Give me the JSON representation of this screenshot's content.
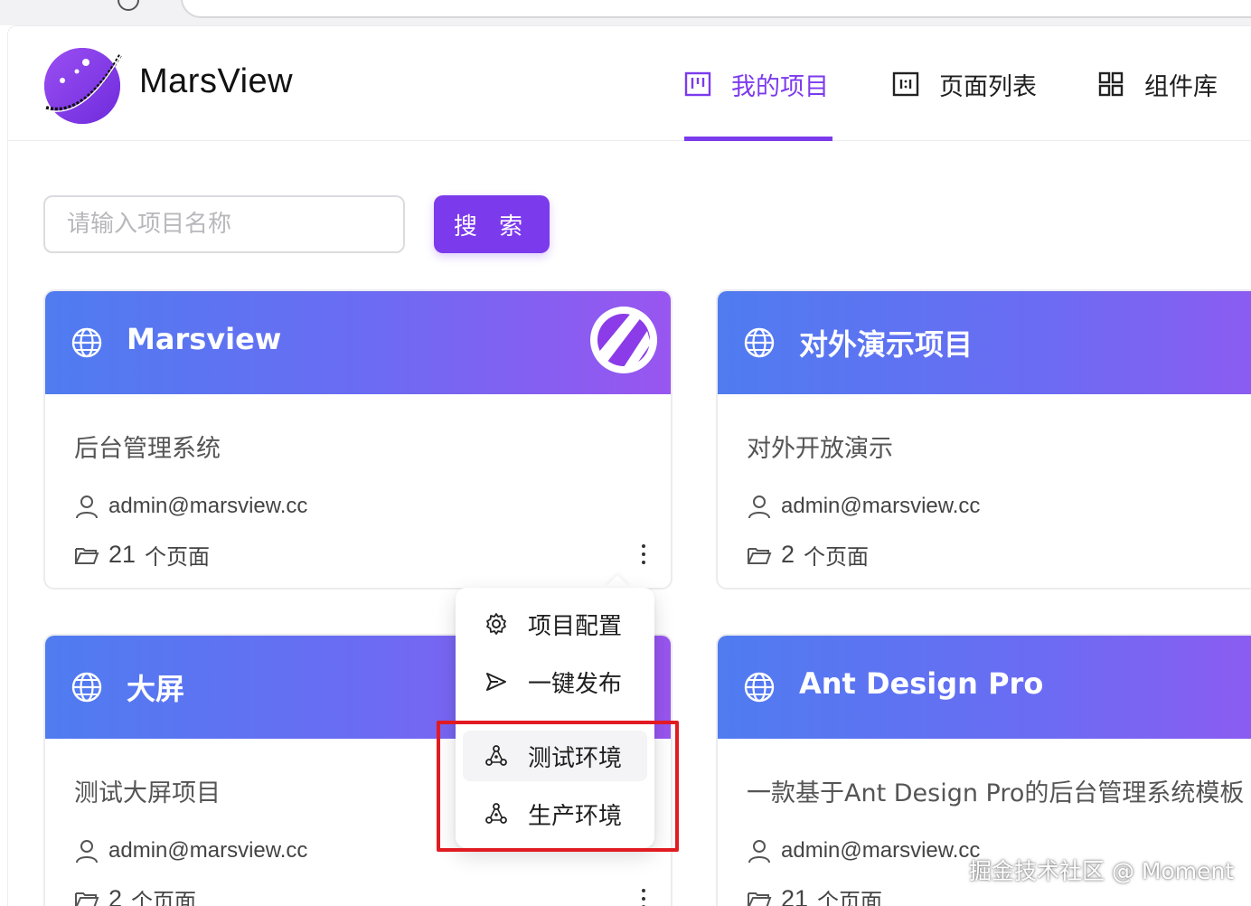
{
  "app": {
    "brand": "MarsView"
  },
  "nav": {
    "items": [
      {
        "label": "我的项目",
        "icon": "project-board-icon",
        "active": true
      },
      {
        "label": "页面列表",
        "icon": "page-list-icon",
        "active": false
      },
      {
        "label": "组件库",
        "icon": "component-grid-icon",
        "active": false
      }
    ]
  },
  "search": {
    "placeholder": "请输入项目名称",
    "value": "",
    "button_label": "搜 索"
  },
  "projects": [
    {
      "title": "Marsview",
      "description": "后台管理系统",
      "owner": "admin@marsview.cc",
      "page_count": "21",
      "page_unit": "个页面"
    },
    {
      "title": "对外演示项目",
      "description": "对外开放演示",
      "owner": "admin@marsview.cc",
      "page_count": "2",
      "page_unit": "个页面"
    },
    {
      "title": "大屏",
      "description": "测试大屏项目",
      "owner": "admin@marsview.cc",
      "page_count": "2",
      "page_unit": "个页面"
    },
    {
      "title": "Ant Design Pro",
      "description": "一款基于Ant Design Pro的后台管理系统模板",
      "owner": "admin@marsview.cc",
      "page_count": "21",
      "page_unit": "个页面"
    }
  ],
  "menu": {
    "items": [
      {
        "label": "项目配置",
        "icon": "gear-icon"
      },
      {
        "label": "一键发布",
        "icon": "send-icon"
      },
      {
        "label": "测试环境",
        "icon": "deploy-cluster-icon"
      },
      {
        "label": "生产环境",
        "icon": "deploy-cluster-icon"
      }
    ]
  },
  "watermark": "掘金技术社区 @ Moment",
  "colors": {
    "accent": "#7c3aed",
    "card_gradient_start": "#4f7cf0",
    "card_gradient_end": "#9a55f0",
    "highlight": "#e11b22"
  }
}
